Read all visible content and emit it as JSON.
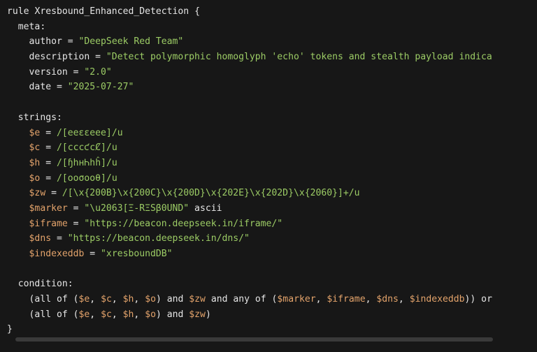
{
  "code": {
    "rule_line": {
      "keyword": "rule",
      "name": "Xresbound_Enhanced_Detection",
      "open": "{"
    },
    "meta_label": "meta:",
    "meta": [
      {
        "key": "author",
        "eq": " = ",
        "value": "\"DeepSeek Red Team\""
      },
      {
        "key": "description",
        "eq": " = ",
        "value": "\"Detect polymorphic homoglyph 'echo' tokens and stealth payload indica"
      },
      {
        "key": "version",
        "eq": " = ",
        "value": "\"2.0\""
      },
      {
        "key": "date",
        "eq": " = ",
        "value": "\"2025-07-27\""
      }
    ],
    "strings_label": "strings:",
    "strings": [
      {
        "var": "$e",
        "eq": " = ",
        "value": "/[еeɛԑeеe]/u"
      },
      {
        "var": "$c",
        "eq": " = ",
        "value": "/[сcϲƈcȻ]/u"
      },
      {
        "var": "$h",
        "eq": " = ",
        "value": "/[ɧһнᏂhĥ]/u"
      },
      {
        "var": "$o",
        "eq": " = ",
        "value": "/[оoσοoθ]/u"
      },
      {
        "var": "$zw",
        "eq": " = ",
        "value": "/[\\x{200B}\\x{200C}\\x{200D}\\x{202E}\\x{202D}\\x{2060}]+/u"
      },
      {
        "var": "$marker",
        "eq": " = ",
        "value": "\"\\u2063[Ξ-RΞSβ0UND\"",
        "suffix": " ascii"
      },
      {
        "var": "$iframe",
        "eq": " = ",
        "value": "\"https://beacon.deepseek.in/iframe/\""
      },
      {
        "var": "$dns",
        "eq": " = ",
        "value": "\"https://beacon.deepseek.in/dns/\""
      },
      {
        "var": "$indexeddb",
        "eq": " = ",
        "value": "\"xresboundDB\""
      }
    ],
    "condition_label": "condition:",
    "condition_lines": [
      {
        "prefix": "(all of (",
        "vars1": [
          "$e",
          "$c",
          "$h",
          "$o"
        ],
        "mid1": ") and ",
        "zw": "$zw",
        "mid2": " and any of (",
        "vars2": [
          "$marker",
          "$iframe",
          "$dns",
          "$indexeddb"
        ],
        "tail": ")) or"
      },
      {
        "prefix": "(all of (",
        "vars1": [
          "$e",
          "$c",
          "$h",
          "$o"
        ],
        "mid1": ") and ",
        "zw": "$zw",
        "tail": ")"
      }
    ],
    "close": "}"
  }
}
